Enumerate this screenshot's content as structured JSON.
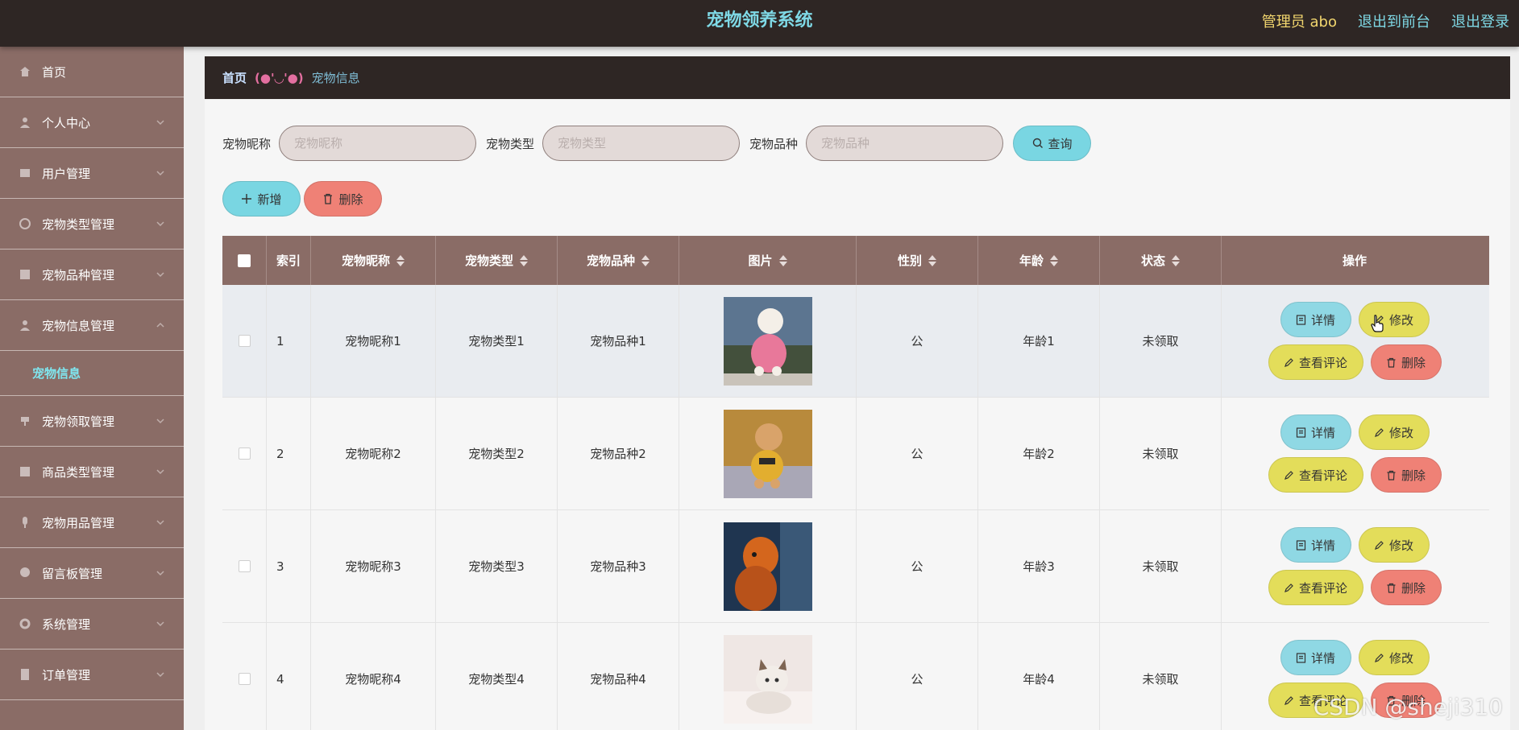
{
  "header": {
    "title": "宠物领养系统",
    "admin": "管理员 abo",
    "front_link": "退出到前台",
    "logout": "退出登录"
  },
  "sidebar": {
    "items": [
      {
        "label": "首页",
        "icon": "home-icon"
      },
      {
        "label": "个人中心",
        "icon": "user-icon"
      },
      {
        "label": "用户管理",
        "icon": "users-icon"
      },
      {
        "label": "宠物类型管理",
        "icon": "category-icon"
      },
      {
        "label": "宠物品种管理",
        "icon": "breed-icon"
      },
      {
        "label": "宠物信息管理",
        "icon": "info-icon"
      },
      {
        "label": "宠物领取管理",
        "icon": "adopt-icon"
      },
      {
        "label": "商品类型管理",
        "icon": "goods-type-icon"
      },
      {
        "label": "宠物用品管理",
        "icon": "supplies-icon"
      },
      {
        "label": "留言板管理",
        "icon": "message-icon"
      },
      {
        "label": "系统管理",
        "icon": "settings-icon"
      },
      {
        "label": "订单管理",
        "icon": "order-icon"
      }
    ],
    "submenu_active": "宠物信息"
  },
  "breadcrumb": {
    "home": "首页",
    "separator": "(●'◡'●)",
    "current": "宠物信息"
  },
  "search": {
    "nickname_label": "宠物昵称",
    "nickname_placeholder": "宠物昵称",
    "type_label": "宠物类型",
    "type_placeholder": "宠物类型",
    "breed_label": "宠物品种",
    "breed_placeholder": "宠物品种",
    "query_button": "查询"
  },
  "actions": {
    "add": "新增",
    "delete": "删除"
  },
  "table": {
    "columns": [
      "索引",
      "宠物昵称",
      "宠物类型",
      "宠物品种",
      "图片",
      "性别",
      "年龄",
      "状态",
      "操作"
    ],
    "rows": [
      {
        "index": "1",
        "nickname": "宠物昵称1",
        "type": "宠物类型1",
        "breed": "宠物品种1",
        "gender": "公",
        "age": "年龄1",
        "status": "未领取"
      },
      {
        "index": "2",
        "nickname": "宠物昵称2",
        "type": "宠物类型2",
        "breed": "宠物品种2",
        "gender": "公",
        "age": "年龄2",
        "status": "未领取"
      },
      {
        "index": "3",
        "nickname": "宠物昵称3",
        "type": "宠物类型3",
        "breed": "宠物品种3",
        "gender": "公",
        "age": "年龄3",
        "status": "未领取"
      },
      {
        "index": "4",
        "nickname": "宠物昵称4",
        "type": "宠物类型4",
        "breed": "宠物品种4",
        "gender": "公",
        "age": "年龄4",
        "status": "未领取"
      }
    ],
    "op_labels": {
      "detail": "详情",
      "edit": "修改",
      "review": "查看评论",
      "delete": "删除"
    }
  },
  "watermark": "CSDN @sheji310",
  "colors": {
    "header_bg": "#2e2624",
    "sidebar_bg": "#8a6c66",
    "accent_cyan": "#79d6e2",
    "accent_yellow": "#e3dd5a",
    "accent_red": "#ef8176"
  }
}
